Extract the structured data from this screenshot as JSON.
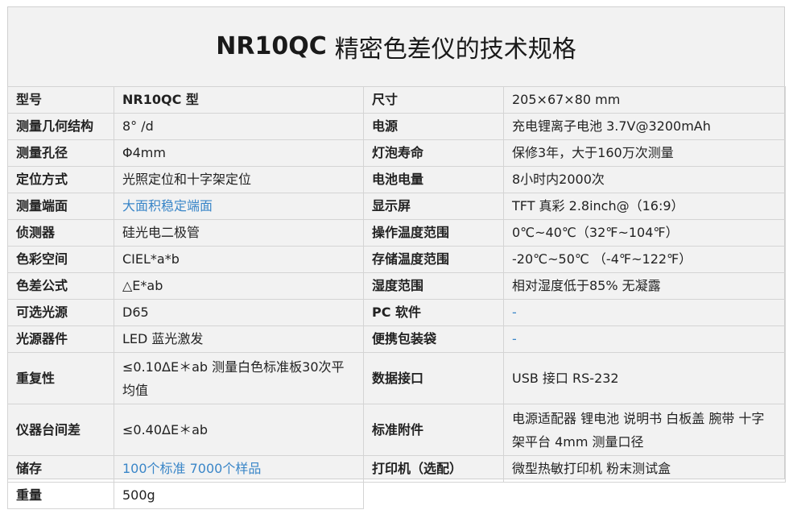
{
  "title": {
    "model": "NR10QC",
    "text": "精密色差仪的技术规格"
  },
  "rows": [
    {
      "k1": "型号",
      "v1": "NR10QC 型",
      "k2": "尺寸",
      "v2": "205×67×80 mm"
    },
    {
      "k1": "测量几何结构",
      "v1": "8°  /d",
      "k2": "电源",
      "v2": "充电锂离子电池  3.7V@3200mAh"
    },
    {
      "k1": "测量孔径",
      "v1": "Φ4mm",
      "k2": "灯泡寿命",
      "v2": "保修3年，大于160万次测量"
    },
    {
      "k1": "定位方式",
      "v1": "光照定位和十字架定位",
      "k2": "电池电量",
      "v2": "8小时内2000次"
    },
    {
      "k1": "测量端面",
      "v1": "大面积稳定端面",
      "k2": "显示屏",
      "v2": "TFT 真彩  2.8inch@（16:9）"
    },
    {
      "k1": "侦测器",
      "v1": "硅光电二极管",
      "k2": "操作温度范围",
      "v2": " 0℃~40℃（32℉~104℉）"
    },
    {
      "k1": "色彩空间",
      "v1": "CIEL*a*b",
      "k2": "存储温度范围",
      "v2": "-20℃~50℃  （-4℉~122℉）"
    },
    {
      "k1": "色差公式",
      "v1": "△E*ab",
      "k2": "湿度范围",
      "v2": "相对湿度低于85%  无凝露"
    },
    {
      "k1": "可选光源",
      "v1": "D65",
      "k2": "PC 软件",
      "v2": "-"
    },
    {
      "k1": "光源器件",
      "v1": "LED 蓝光激发",
      "k2": "便携包装袋",
      "v2": "-"
    },
    {
      "k1": "重复性",
      "v1": "≤0.10ΔE＊ab  测量白色标准板30次平均值",
      "k2": "数据接口",
      "v2": "USB 接口    RS-232"
    },
    {
      "k1": "仪器台间差",
      "v1": "≤0.40ΔE＊ab",
      "k2": "标准附件",
      "v2": "电源适配器  锂电池  说明书  白板盖  腕带  十字架平台 4mm 测量口径"
    },
    {
      "k1": "储存",
      "v1": "100个标准  7000个样品",
      "k2": "打印机（选配）",
      "v2": "微型热敏打印机  粉末测试盒"
    },
    {
      "k1": "重量",
      "v1": "500g"
    }
  ]
}
